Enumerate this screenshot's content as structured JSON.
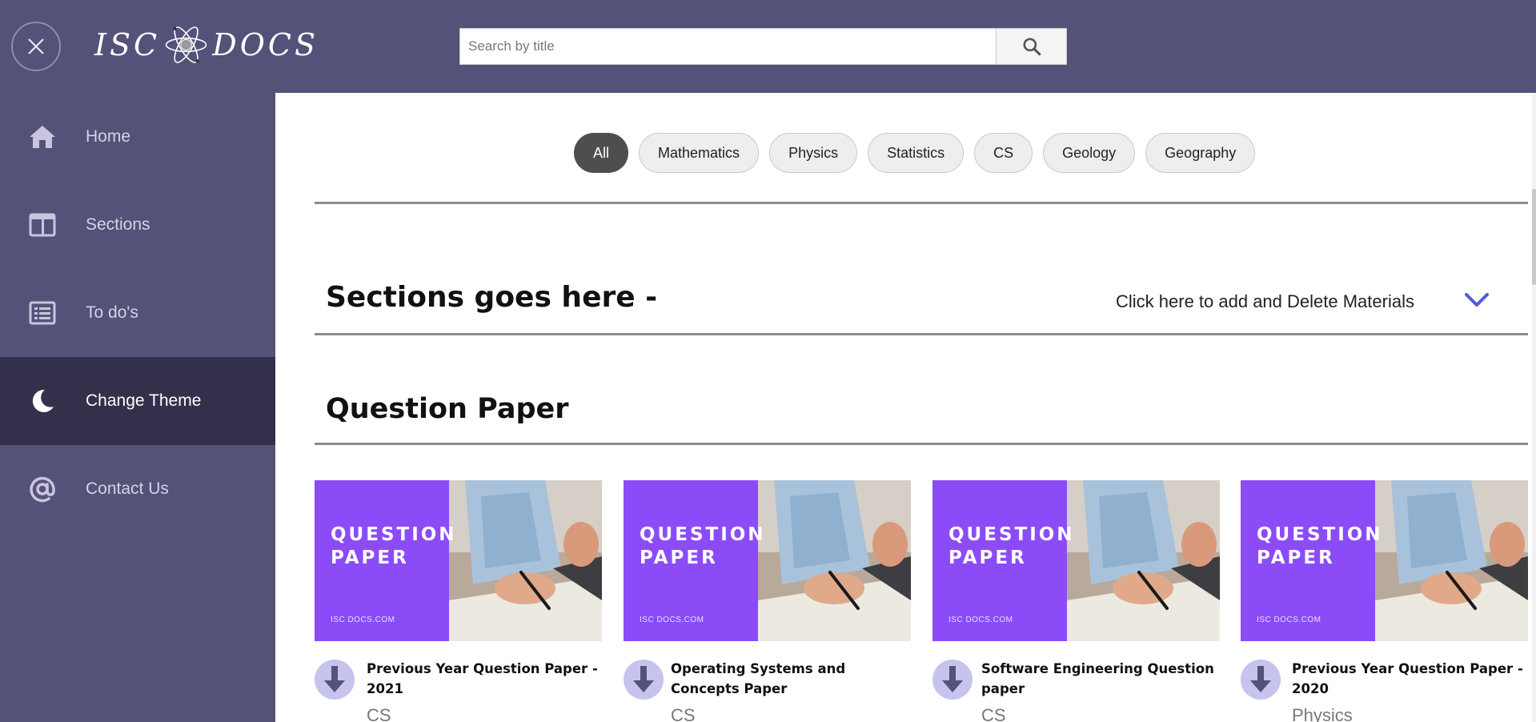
{
  "header": {
    "logo_left": "ISC",
    "logo_right": "DOCS",
    "search_placeholder": "Search by title"
  },
  "sidebar": {
    "items": [
      {
        "label": "Home",
        "icon": "home-icon"
      },
      {
        "label": "Sections",
        "icon": "sections-icon"
      },
      {
        "label": "To do's",
        "icon": "todo-list-icon"
      },
      {
        "label": "Change Theme",
        "icon": "moon-icon",
        "active": true
      },
      {
        "label": "Contact Us",
        "icon": "at-sign-icon"
      }
    ]
  },
  "filters": {
    "chips": [
      "All",
      "Mathematics",
      "Physics",
      "Statistics",
      "CS",
      "Geology",
      "Geography"
    ],
    "selected": "All"
  },
  "sections": {
    "heading": "Sections goes here -",
    "add_link": "Click here to add and Delete Materials"
  },
  "question_paper": {
    "heading": "Question Paper",
    "thumb_title_line1": "QUESTION",
    "thumb_title_line2": "PAPER",
    "thumb_site": "ISC DOCS.COM",
    "cards": [
      {
        "title": "Previous Year Question Paper - 2021",
        "subject": "CS"
      },
      {
        "title": "Operating Systems and Concepts Paper",
        "subject": "CS"
      },
      {
        "title": "Software Engineering Question paper",
        "subject": "CS"
      },
      {
        "title": "Previous Year Question Paper - 2020",
        "subject": "Physics"
      }
    ]
  },
  "colors": {
    "sidebar_bg": "#545278",
    "sidebar_active": "#33304b",
    "thumb_purple": "#8b4cf7",
    "accent_chevron": "#4f5bd5"
  }
}
